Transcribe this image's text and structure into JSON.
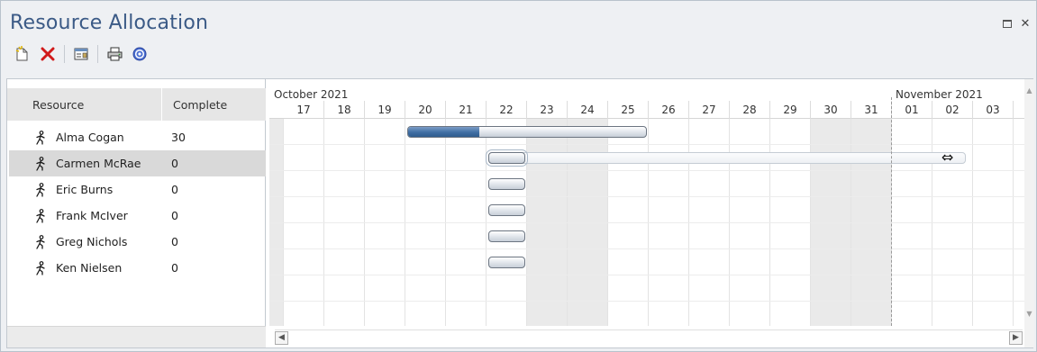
{
  "window": {
    "title": "Resource Allocation"
  },
  "toolbar": {
    "items": [
      {
        "icon": "new-document-icon"
      },
      {
        "icon": "delete-icon"
      },
      {
        "icon": "properties-icon"
      },
      {
        "icon": "print-icon"
      },
      {
        "icon": "help-icon"
      }
    ]
  },
  "table": {
    "headers": {
      "resource": "Resource",
      "complete": "Complete"
    },
    "rows": [
      {
        "name": "Alma Cogan",
        "complete": "30"
      },
      {
        "name": "Carmen McRae",
        "complete": "0"
      },
      {
        "name": "Eric Burns",
        "complete": "0"
      },
      {
        "name": "Frank McIver",
        "complete": "0"
      },
      {
        "name": "Greg Nichols",
        "complete": "0"
      },
      {
        "name": "Ken Nielsen",
        "complete": "0"
      }
    ]
  },
  "gantt": {
    "months": [
      "October 2021",
      "November 2021"
    ],
    "days": [
      "17",
      "18",
      "19",
      "20",
      "21",
      "22",
      "23",
      "24",
      "25",
      "26",
      "27",
      "28",
      "29",
      "30",
      "31",
      "01",
      "02",
      "03"
    ],
    "weekend_days": [
      "23",
      "24",
      "30",
      "31"
    ],
    "bars": [
      {
        "row": 0,
        "start": "20",
        "end": "25",
        "progress": 0.3
      },
      {
        "row": 1,
        "start": "22",
        "end": "22",
        "selected": true,
        "ghost_end": "02"
      },
      {
        "row": 2,
        "start": "22",
        "end": "22"
      },
      {
        "row": 3,
        "start": "22",
        "end": "22"
      },
      {
        "row": 4,
        "start": "22",
        "end": "22"
      },
      {
        "row": 5,
        "start": "22",
        "end": "22"
      }
    ]
  },
  "colors": {
    "title": "#3b5a86",
    "progress": "#3f6ea3",
    "weekend": "#eaeaea",
    "selected_row": "#d9d9d9"
  }
}
